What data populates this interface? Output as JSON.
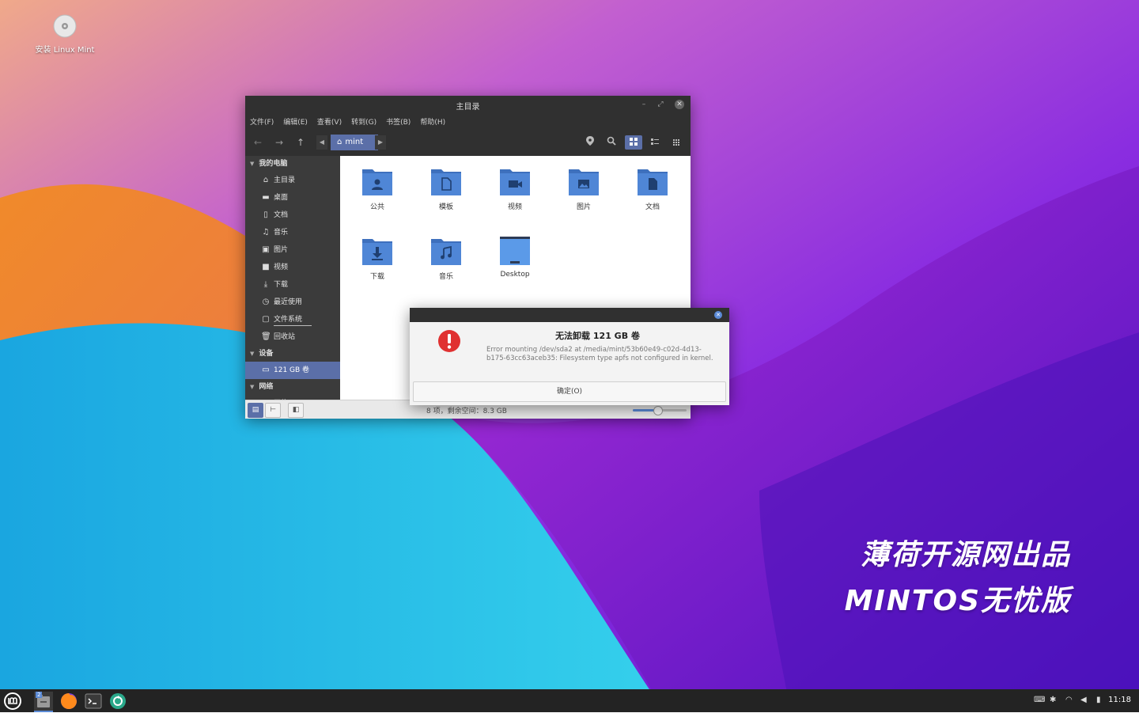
{
  "desktop": {
    "icon_label": "安装 Linux Mint",
    "brand_line1": "薄荷开源网出品",
    "brand_line2": "MINTOS无忧版"
  },
  "window": {
    "title": "主目录",
    "menu": [
      "文件(F)",
      "编辑(E)",
      "查看(V)",
      "转到(G)",
      "书签(B)",
      "帮助(H)"
    ],
    "path": "mint",
    "sidebar": {
      "section_computer": "我的电脑",
      "items": [
        {
          "label": "主目录",
          "icon": "home-icon"
        },
        {
          "label": "桌面",
          "icon": "desktop-icon"
        },
        {
          "label": "文档",
          "icon": "document-icon"
        },
        {
          "label": "音乐",
          "icon": "music-icon"
        },
        {
          "label": "图片",
          "icon": "picture-icon"
        },
        {
          "label": "视频",
          "icon": "video-icon"
        },
        {
          "label": "下载",
          "icon": "download-icon"
        },
        {
          "label": "最近使用",
          "icon": "recent-icon"
        },
        {
          "label": "文件系统",
          "icon": "filesystem-icon"
        },
        {
          "label": "回收站",
          "icon": "trash-icon"
        }
      ],
      "section_devices": "设备",
      "device": "121 GB 卷",
      "section_network": "网络",
      "network_item": "网络"
    },
    "files": [
      {
        "label": "公共",
        "icon": "public-folder-icon"
      },
      {
        "label": "模板",
        "icon": "templates-folder-icon"
      },
      {
        "label": "视频",
        "icon": "videos-folder-icon"
      },
      {
        "label": "图片",
        "icon": "pictures-folder-icon"
      },
      {
        "label": "文档",
        "icon": "documents-folder-icon"
      },
      {
        "label": "下载",
        "icon": "downloads-folder-icon"
      },
      {
        "label": "音乐",
        "icon": "music-folder-icon"
      },
      {
        "label": "Desktop",
        "icon": "desktop-folder-icon"
      }
    ],
    "status": "8 项，剩余空间：8.3 GB",
    "zoom_fraction": 0.45
  },
  "dialog": {
    "title": "无法卸载 121 GB 卷",
    "message": "Error mounting /dev/sda2 at /media/mint/53b60e49-c02d-4d13-b175-63cc63aceb35: Filesystem type apfs not configured in kernel.",
    "ok_label": "确定(O)"
  },
  "taskbar": {
    "workspace_badge": "2",
    "clock": "11:18"
  },
  "colors": {
    "accent": "#5b6fa8",
    "folder": "#4f86d6",
    "error": "#e03131"
  }
}
